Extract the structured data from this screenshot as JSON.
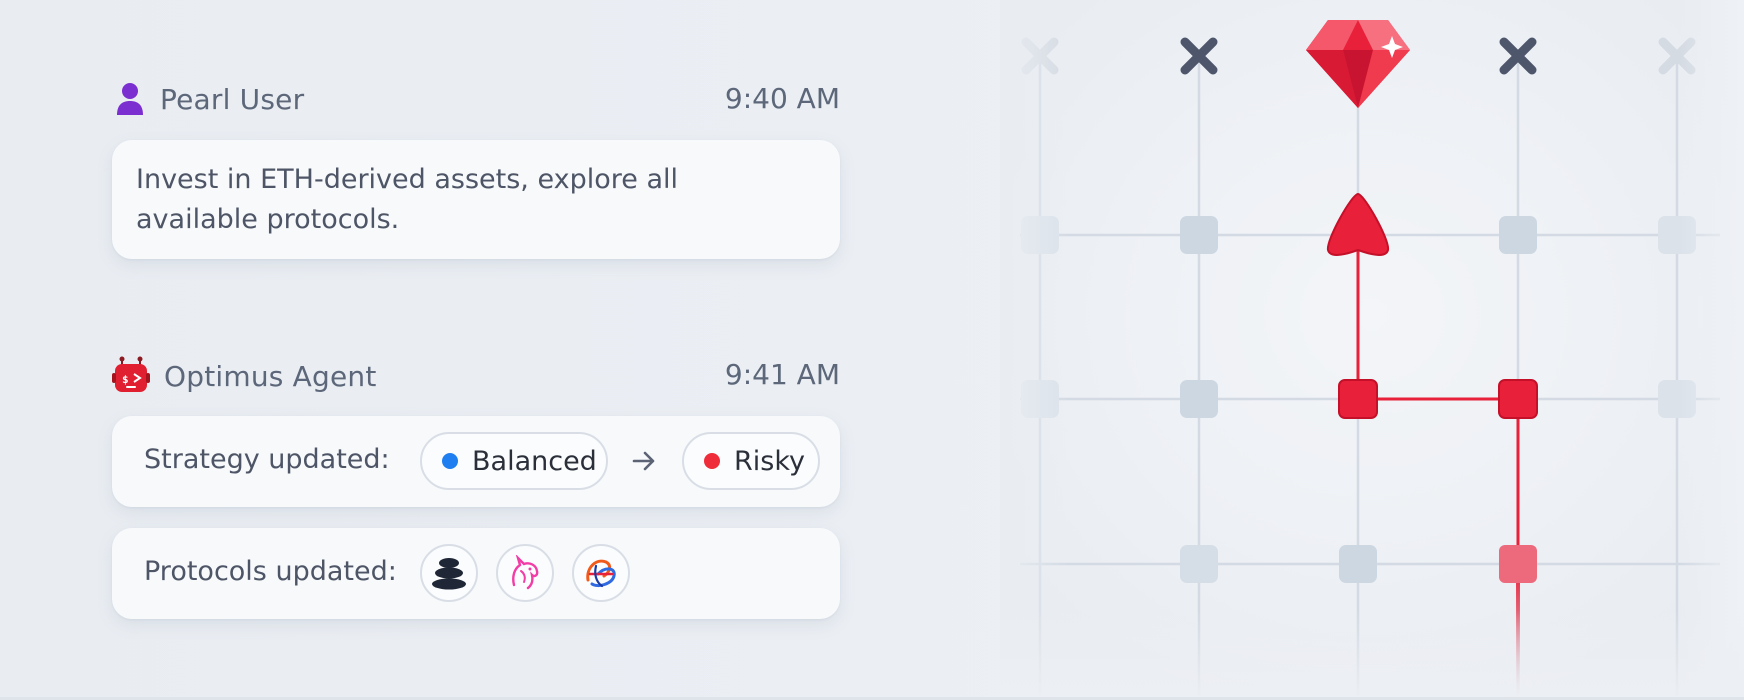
{
  "user_message": {
    "sender": "Pearl User",
    "time": "9:40 AM",
    "text": "Invest in ETH-derived assets, explore all available protocols.",
    "avatar_icon": "person-icon",
    "avatar_color": "#7b2fd0"
  },
  "agent_message": {
    "sender": "Optimus Agent",
    "time": "9:41 AM",
    "avatar_icon": "robot-icon",
    "avatar_color": "#e02030",
    "strategy": {
      "label": "Strategy updated:",
      "from": {
        "label": "Balanced",
        "color": "#1f7ff0"
      },
      "arrow_icon": "arrow-right-icon",
      "to": {
        "label": "Risky",
        "color": "#ef2c3a"
      }
    },
    "protocols": {
      "label": "Protocols updated:",
      "icons": [
        "stacked-coins-icon",
        "unicorn-icon",
        "balancer-swirl-icon"
      ]
    }
  },
  "path_graphic": {
    "goal_icon": "ruby-gem-icon",
    "blocked_icon": "x-mark-icon",
    "accent": "#e8203a",
    "node_color": "#cdd7e1"
  }
}
